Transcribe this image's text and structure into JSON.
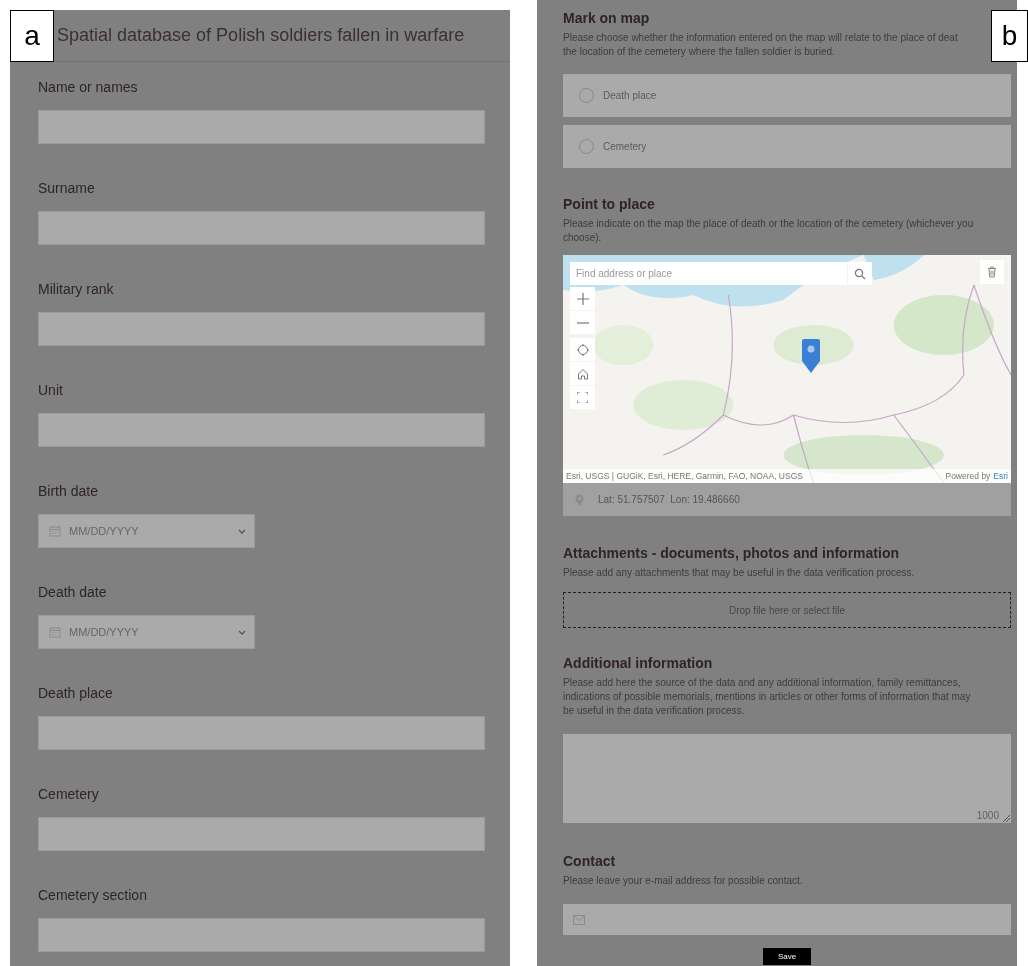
{
  "panel_a": {
    "letter": "a",
    "title": "Spatial database of Polish soldiers fallen in warfare",
    "fields": [
      {
        "label": "Name or names",
        "kind": "text"
      },
      {
        "label": "Surname",
        "kind": "text"
      },
      {
        "label": "Military rank",
        "kind": "text"
      },
      {
        "label": "Unit",
        "kind": "text"
      },
      {
        "label": "Birth date",
        "kind": "date",
        "placeholder": "MM/DD/YYYY"
      },
      {
        "label": "Death date",
        "kind": "date",
        "placeholder": "MM/DD/YYYY"
      },
      {
        "label": "Death place",
        "kind": "text"
      },
      {
        "label": "Cemetery",
        "kind": "text"
      },
      {
        "label": "Cemetery section",
        "kind": "text"
      }
    ]
  },
  "panel_b": {
    "letter": "b",
    "sections": [
      {
        "kind": "radio",
        "heading": "Mark on map",
        "description_lines": [
          "Please choose whether the information entered on the map will relate to the place of deat",
          "the location of the cemetery where the fallen soldier is buried."
        ],
        "options": [
          {
            "label": "Death place",
            "selected": false
          },
          {
            "label": "Cemetery",
            "selected": false
          }
        ]
      },
      {
        "kind": "map",
        "heading": "Point to place",
        "description_lines": [
          "Please indicate on the map the place of death or the location of the cemetery (whichever you",
          "choose)."
        ],
        "search_placeholder": "Find address or place",
        "attribution": "Esri, USGS | GUGiK, Esri, HERE, Garmin, FAO, NOAA, USGS",
        "powered_by": "Powered by",
        "powered_link": "Esri",
        "coordinates": "Lat: 51.757507  Lon: 19.486660"
      },
      {
        "kind": "upload",
        "heading": "Attachments - documents, photos and information",
        "description_lines": [
          "Please add any attachments that may be useful in the data verification process."
        ],
        "drop_text": "Drop file here or select file"
      },
      {
        "kind": "textarea",
        "heading": "Additional information",
        "description_lines": [
          "Please add here the source of the data and any additional information, family remittances,",
          "indications of possible memorials, mentions in articles or other forms of information that may",
          "be useful in the data verification process."
        ],
        "counter": "1000"
      },
      {
        "kind": "email",
        "heading": "Contact",
        "description_lines": [
          "Please leave your e-mail address for possible contact."
        ]
      }
    ],
    "save_button": "Save"
  }
}
